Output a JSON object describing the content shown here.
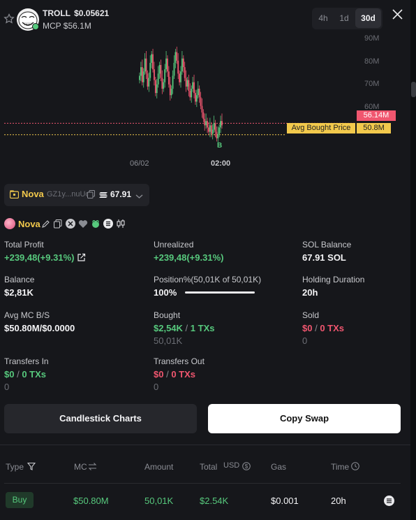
{
  "header": {
    "symbol": "TROLL",
    "price": "$0.05621",
    "mcp_label": "MCP $56.1M",
    "timeframes": [
      "4h",
      "1d",
      "30d"
    ],
    "active_timeframe": "30d"
  },
  "chart_data": {
    "type": "candlestick",
    "y_ticks": [
      "90M",
      "80M",
      "70M",
      "60M"
    ],
    "x_ticks": [
      "06/02",
      "02:00"
    ],
    "current_price_label": "56.14M",
    "avg_bought_label": "Avg Bought Price",
    "avg_bought_value": "50.8M",
    "buy_marker": "B",
    "ylim": [
      47,
      95
    ],
    "current_value": 56.14,
    "avg_value": 50.8,
    "closes": [
      78,
      82,
      75,
      80,
      86,
      79,
      73,
      77,
      84,
      88,
      81,
      76,
      70,
      74,
      79,
      83,
      77,
      72,
      75,
      81,
      86,
      80,
      74,
      69,
      72,
      78,
      84,
      89,
      85,
      79,
      75,
      80,
      86,
      82,
      77,
      73,
      76,
      71,
      68,
      72,
      75,
      70,
      66,
      69,
      72,
      68,
      64,
      61,
      58,
      55,
      57,
      54,
      52,
      55,
      51,
      53,
      56,
      52,
      49,
      51,
      54,
      57,
      55
    ]
  },
  "wallet": {
    "name": "Nova",
    "address": "GZ1y...nuUo",
    "balance": "67.91"
  },
  "profile": {
    "name": "Nova"
  },
  "stats": {
    "total_profit_label": "Total Profit",
    "total_profit_value": "+239,48(+9.31%)",
    "unrealized_label": "Unrealized",
    "unrealized_value": "+239,48(+9.31%)",
    "sol_balance_label": "SOL Balance",
    "sol_balance_value": "67.91 SOL",
    "balance_label": "Balance",
    "balance_value": "$2,81K",
    "position_label": "Position%(50,01K of 50,01K)",
    "position_value": "100%",
    "position_fill": 1.0,
    "holding_label": "Holding Duration",
    "holding_value": "20h",
    "avg_mc_label": "Avg MC B/S",
    "avg_mc_value": "$50.80M/$0.0000",
    "bought_label": "Bought",
    "bought_usd": "$2,54K",
    "bought_sep": "/",
    "bought_txs": "1 TXs",
    "bought_amount": "50,01K",
    "sold_label": "Sold",
    "sold_usd": "$0",
    "sold_sep": "/",
    "sold_txs": "0 TXs",
    "sold_amount": "0",
    "transfers_in_label": "Transfers In",
    "transfers_in_usd": "$0",
    "transfers_in_sep": "/",
    "transfers_in_txs": "0 TXs",
    "transfers_in_amount": "0",
    "transfers_out_label": "Transfers Out",
    "transfers_out_usd": "$0",
    "transfers_out_sep": "/",
    "transfers_out_txs": "0 TXs",
    "transfers_out_amount": "0"
  },
  "actions": {
    "candlestick_label": "Candlestick Charts",
    "copy_swap_label": "Copy Swap"
  },
  "table": {
    "headers": {
      "type": "Type",
      "mc": "MC",
      "amount": "Amount",
      "total": "Total",
      "usd": "USD",
      "gas": "Gas",
      "time": "Time"
    },
    "rows": [
      {
        "type": "Buy",
        "mc": "$50.80M",
        "amount": "50,01K",
        "total": "$2.54K",
        "gas": "$0.001",
        "time": "20h"
      }
    ]
  }
}
